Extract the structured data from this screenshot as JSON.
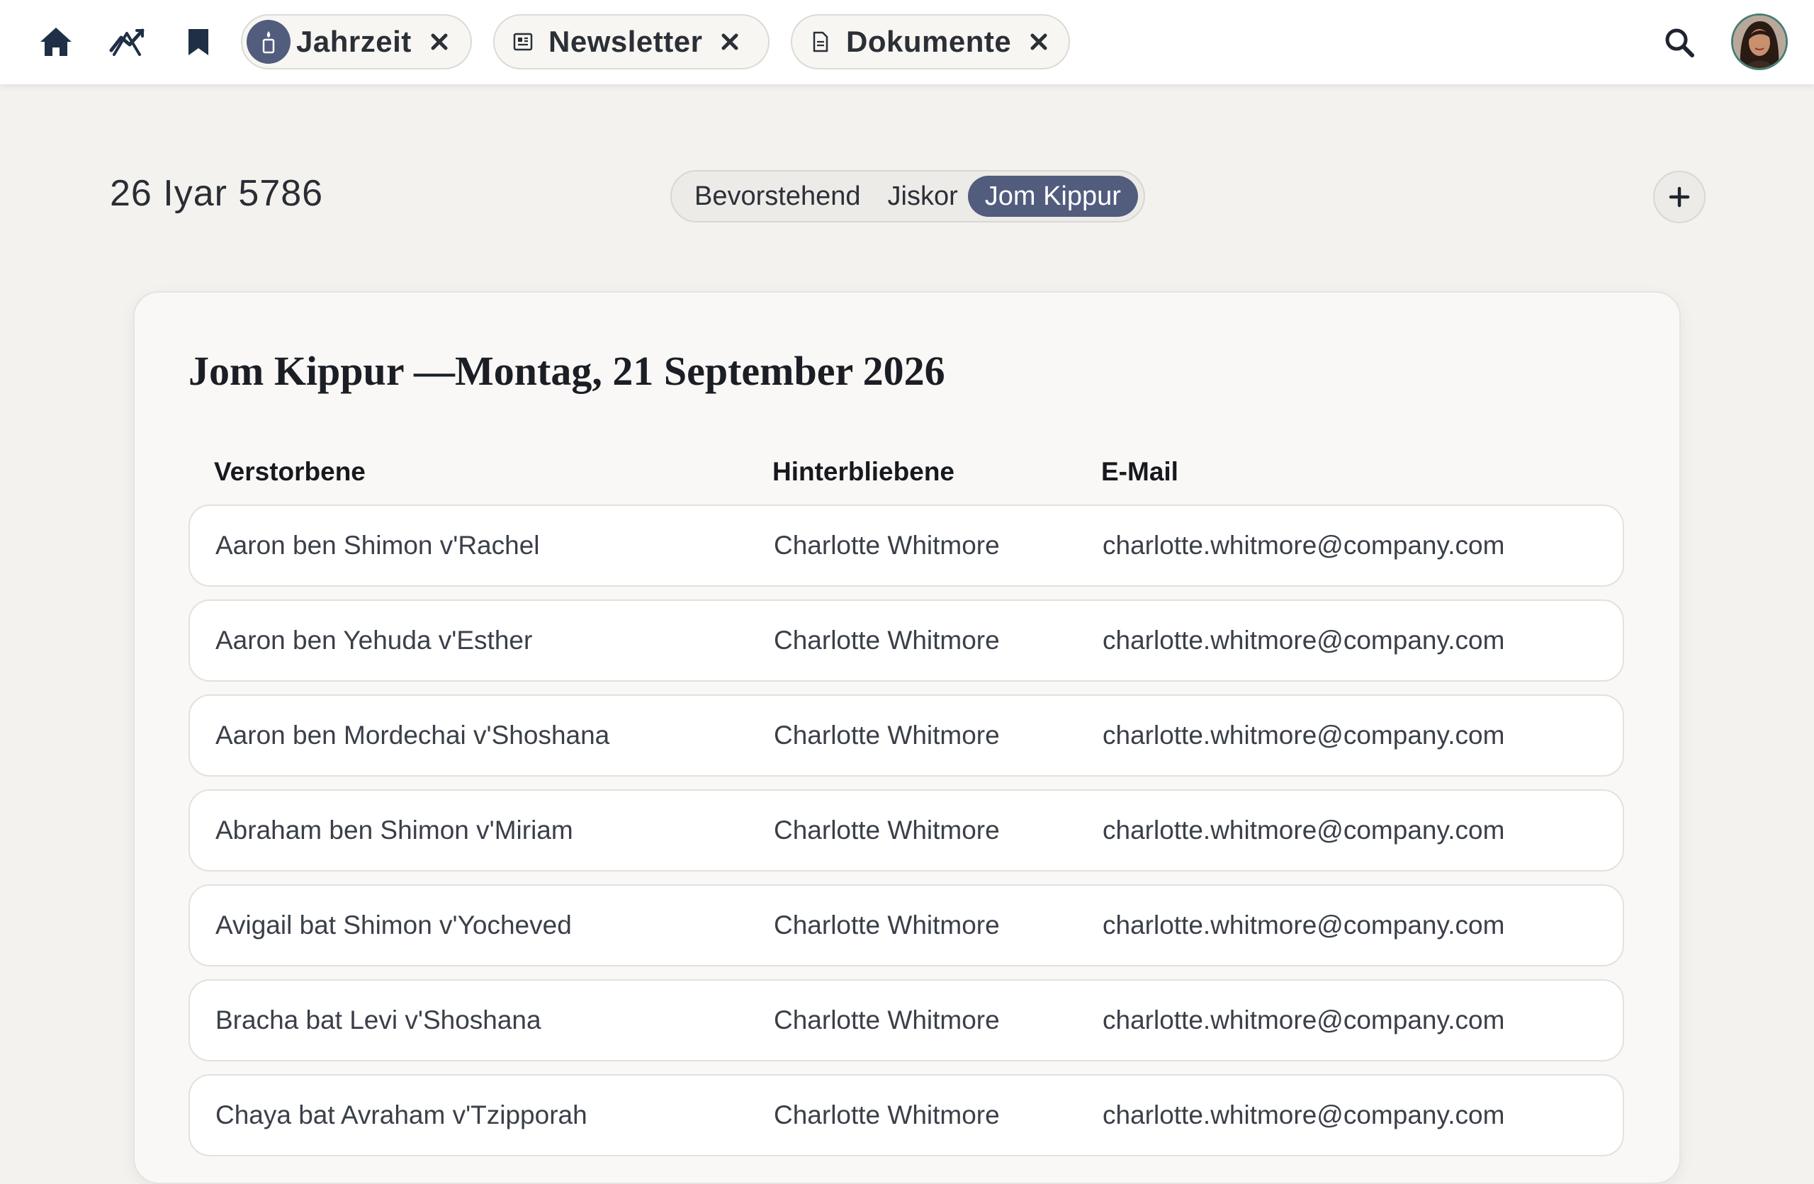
{
  "tabs": [
    {
      "label": "Jahrzeit",
      "icon": "candle-icon",
      "active": true
    },
    {
      "label": "Newsletter",
      "icon": "newspaper-icon",
      "active": false
    },
    {
      "label": "Dokumente",
      "icon": "document-icon",
      "active": false
    }
  ],
  "nav_icons": [
    "home-icon",
    "chart-icon",
    "bookmark-icon"
  ],
  "header": {
    "hebrew_date": "26 Iyar 5786",
    "segments": [
      "Bevorstehend",
      "Jiskor",
      "Jom Kippur"
    ],
    "active_segment": "Jom Kippur"
  },
  "card": {
    "title": "Jom Kippur —Montag, 21 September 2026",
    "columns": [
      "Verstorbene",
      "Hinterbliebene",
      "E-Mail"
    ],
    "rows": [
      {
        "deceased": "Aaron ben Shimon v'Rachel",
        "mourner": "Charlotte Whitmore",
        "email": "charlotte.whitmore@company.com"
      },
      {
        "deceased": "Aaron ben Yehuda v'Esther",
        "mourner": "Charlotte Whitmore",
        "email": "charlotte.whitmore@company.com"
      },
      {
        "deceased": "Aaron ben Mordechai v'Shoshana",
        "mourner": "Charlotte Whitmore",
        "email": "charlotte.whitmore@company.com"
      },
      {
        "deceased": "Abraham ben Shimon v'Miriam",
        "mourner": "Charlotte Whitmore",
        "email": "charlotte.whitmore@company.com"
      },
      {
        "deceased": "Avigail bat Shimon v'Yocheved",
        "mourner": "Charlotte Whitmore",
        "email": "charlotte.whitmore@company.com"
      },
      {
        "deceased": "Bracha bat Levi v'Shoshana",
        "mourner": "Charlotte Whitmore",
        "email": "charlotte.whitmore@company.com"
      },
      {
        "deceased": "Chaya bat Avraham v'Tzipporah",
        "mourner": "Charlotte Whitmore",
        "email": "charlotte.whitmore@company.com"
      }
    ]
  },
  "colors": {
    "accent": "#525c7d",
    "background": "#f3f2ef",
    "card": "#f9f8f6",
    "avatar_ring": "#4a7d73"
  }
}
